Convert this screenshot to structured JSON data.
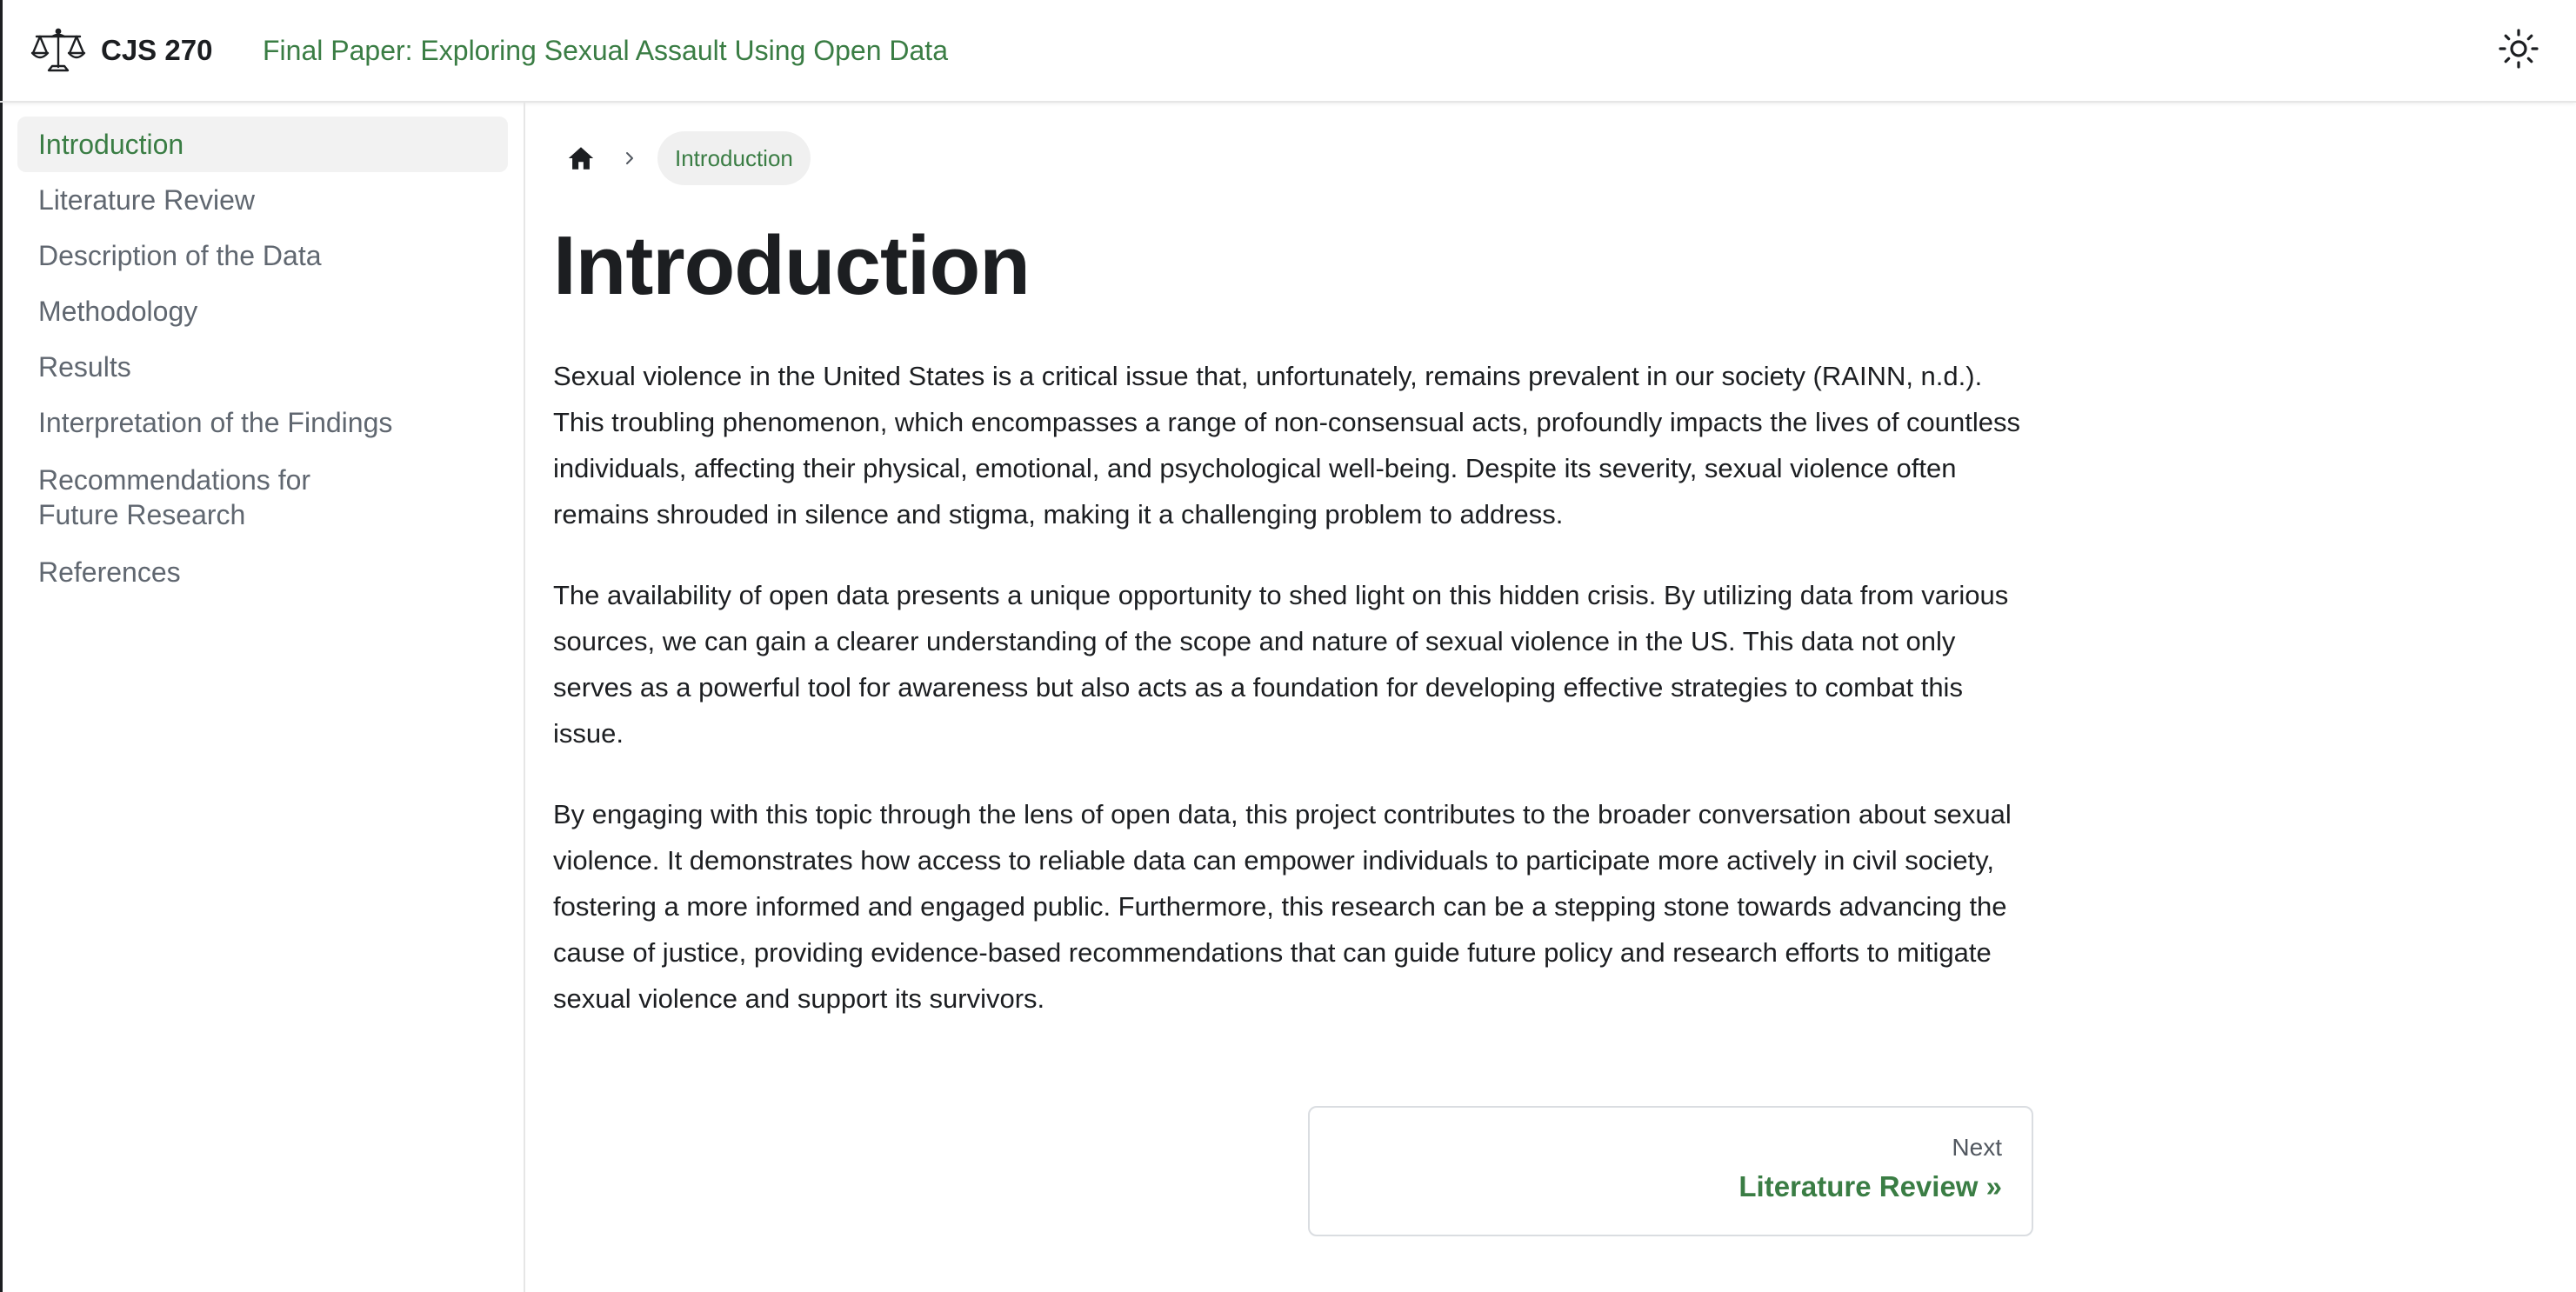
{
  "navbar": {
    "brand": "CJS 270",
    "link": "Final Paper: Exploring Sexual Assault Using Open Data",
    "logo_icon": "scales-of-justice-icon",
    "theme_icon": "sun-icon"
  },
  "sidebar": {
    "items": [
      {
        "label": "Introduction",
        "active": true
      },
      {
        "label": "Literature Review"
      },
      {
        "label": "Description of the Data"
      },
      {
        "label": "Methodology"
      },
      {
        "label": "Results"
      },
      {
        "label": "Interpretation of the Findings"
      },
      {
        "label": "Recommendations for Future Research"
      },
      {
        "label": "References"
      }
    ]
  },
  "breadcrumb": {
    "home_icon": "home-icon",
    "current": "Introduction"
  },
  "page": {
    "title": "Introduction",
    "paragraphs": [
      "Sexual violence in the United States is a critical issue that, unfortunately, remains prevalent in our society (RAINN, n.d.). This troubling phenomenon, which encompasses a range of non-consensual acts, profoundly impacts the lives of countless individuals, affecting their physical, emotional, and psychological well-being. Despite its severity, sexual violence often remains shrouded in silence and stigma, making it a challenging problem to address.",
      "The availability of open data presents a unique opportunity to shed light on this hidden crisis. By utilizing data from various sources, we can gain a clearer understanding of the scope and nature of sexual violence in the US. This data not only serves as a powerful tool for awareness but also acts as a foundation for developing effective strategies to combat this issue.",
      "By engaging with this topic through the lens of open data, this project contributes to the broader conversation about sexual violence. It demonstrates how access to reliable data can empower individuals to participate more actively in civil society, fostering a more informed and engaged public. Furthermore, this research can be a stepping stone towards advancing the cause of justice, providing evidence-based recommendations that can guide future policy and research efforts to mitigate sexual violence and support its survivors."
    ]
  },
  "pager": {
    "sub_label": "Next",
    "label": "Literature Review »"
  },
  "colors": {
    "accent": "#3a7d44",
    "text": "#1c1e21",
    "muted": "#606770",
    "active_bg": "#f2f2f2"
  }
}
